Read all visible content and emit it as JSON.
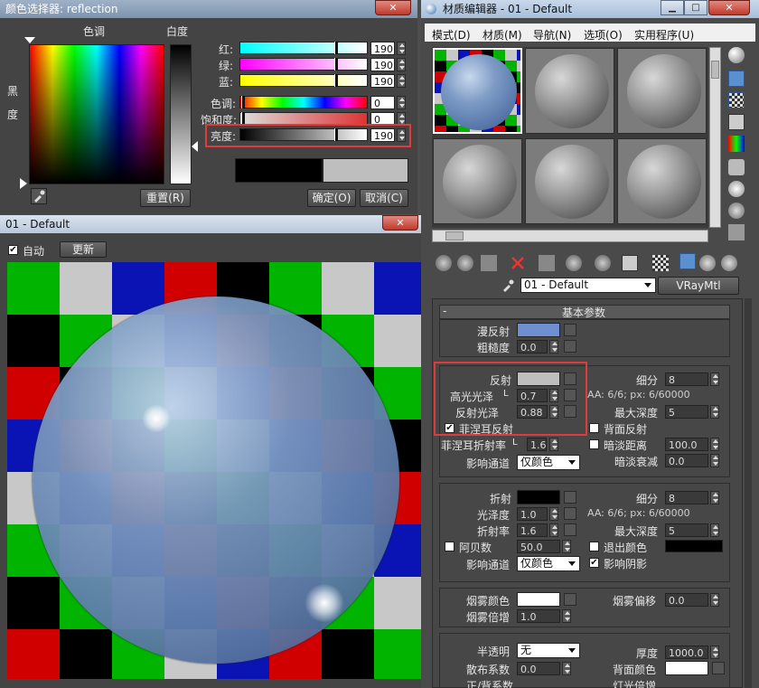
{
  "color_picker": {
    "title": "颜色选择器: reflection",
    "close": "✕",
    "hue_label": "色调",
    "whiteness_label": "白度",
    "black_label": "黑",
    "degree_label": "度",
    "red_label": "红:",
    "green_label": "绿:",
    "blue_label": "蓝:",
    "hue_row_label": "色调:",
    "sat_label": "饱和度:",
    "bright_label": "亮度:",
    "red": "190",
    "green": "190",
    "blue": "190",
    "hue": "0",
    "saturation": "0",
    "brightness": "190",
    "brightness_fraction": 0.745,
    "reset": "重置(R)",
    "ok": "确定(O)",
    "cancel": "取消(C)",
    "new_color": "#bebebe",
    "old_color": "#000000"
  },
  "preview": {
    "title": "01 - Default",
    "close": "✕",
    "auto_label": "自动",
    "update_button": "更新"
  },
  "mat_editor": {
    "title": "材质编辑器 - 01 - Default",
    "min": "▁",
    "max": "□",
    "close": "✕",
    "menu": [
      "模式(D)",
      "材质(M)",
      "导航(N)",
      "选项(O)",
      "实用程序(U)"
    ],
    "material_name": "01 - Default",
    "material_type": "VRayMtl",
    "rollout": "基本参数",
    "diffuse": "漫反射",
    "roughness": "粗糙度",
    "roughness_val": "0.0",
    "reflect": "反射",
    "hilight_gloss": "高光光泽",
    "lock": "L",
    "hilight_val": "0.7",
    "refl_gloss": "反射光泽",
    "refl_gloss_val": "0.88",
    "fresnel": "菲涅耳反射",
    "fresnel_ior": "菲涅耳折射率",
    "fresnel_ior_val": "1.6",
    "affect_channels": "影响通道",
    "color_only": "仅颜色",
    "subdivs": "细分",
    "subdivs_val": "8",
    "aa_info": "AA: 6/6; px: 6/60000",
    "max_depth": "最大深度",
    "max_depth_val": "5",
    "back_reflect": "背面反射",
    "dim_distance": "暗淡距离",
    "dim_distance_val": "100.0",
    "dim_falloff": "暗淡衰减",
    "dim_falloff_val": "0.0",
    "refract": "折射",
    "glossiness": "光泽度",
    "glossiness_val": "1.0",
    "ior": "折射率",
    "ior_val": "1.6",
    "abbe": "阿贝数",
    "abbe_val": "50.0",
    "refr_subdivs_val": "8",
    "refr_max_depth_val": "5",
    "exit_color": "退出颜色",
    "affect_shadows": "影响阴影",
    "fog_color": "烟雾颜色",
    "fog_mult": "烟雾倍增",
    "fog_mult_val": "1.0",
    "fog_bias": "烟雾偏移",
    "fog_bias_val": "0.0",
    "translucency": "半透明",
    "translucency_val": "无",
    "thickness": "厚度",
    "thickness_val": "1000.0",
    "scatter_coeff": "散布系数",
    "scatter_val": "0.0",
    "back_color": "背面颜色",
    "cut_label": "正/背系数",
    "light_mult": "灯光倍增"
  }
}
